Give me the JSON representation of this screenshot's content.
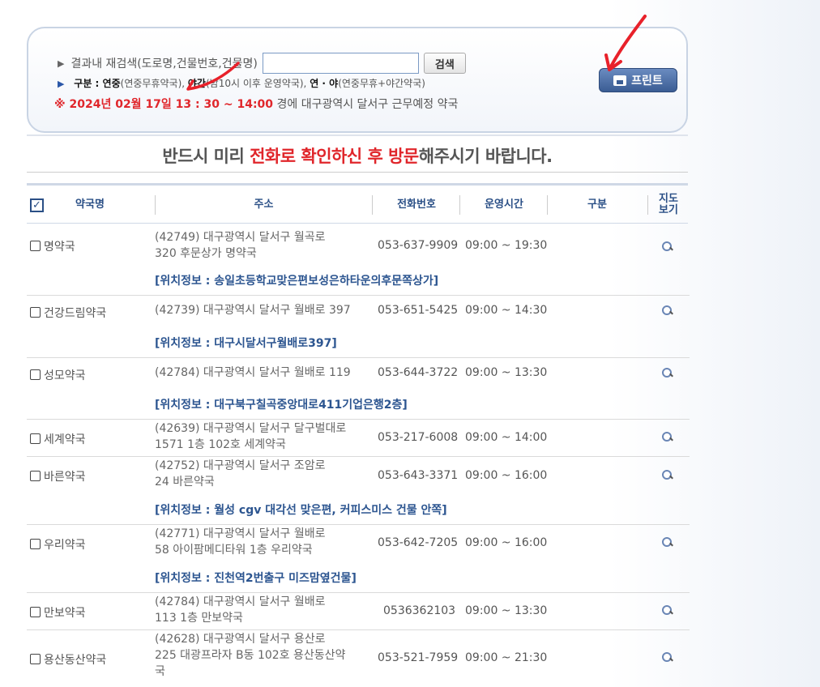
{
  "search": {
    "label": "결과내 재검색(도로명,건물번호,건물명)",
    "input_value": "",
    "button_label": "검색",
    "print_label": "프린트"
  },
  "category": {
    "prefix": "구분 : ",
    "yeonjung": "연중",
    "yeonjung_desc": "(연중무휴약국), ",
    "yagan": "야간",
    "yagan_desc": "(밤10시 이후 운영약국), ",
    "yeonya": "연 · 야",
    "yeonya_desc": "(연중무휴+야간약국)"
  },
  "datetime": {
    "mark": "※ 2024년 02월 17일 13 : 30 ~ 14:00",
    "suffix": " 경에  대구광역시  달서구   근무예정 약국"
  },
  "notice": {
    "pre": "반드시 미리 ",
    "highlight": "전화로 확인하신 후 방문",
    "post": "해주시기 바랍니다."
  },
  "table": {
    "headers": {
      "name": "약국명",
      "address": "주소",
      "phone": "전화번호",
      "hours": "운영시간",
      "category": "구분",
      "map": "지도 보기"
    },
    "rows": [
      {
        "name": "명약국",
        "addr1": "(42749) 대구광역시 달서구 월곡로",
        "addr2": "320 후문상가 명약국",
        "phone": "053-637-9909",
        "hours": "09:00 ~ 19:30",
        "location": "[위치정보 : 송일초등학교맞은편보성은하타운의후문쪽상가]"
      },
      {
        "name": "건강드림약국",
        "addr1": "(42739) 대구광역시 달서구 월배로 397",
        "addr2": "",
        "phone": "053-651-5425",
        "hours": "09:00 ~ 14:30",
        "location": "[위치정보 : 대구시달서구월배로397]"
      },
      {
        "name": "성모약국",
        "addr1": "(42784) 대구광역시 달서구 월배로 119",
        "addr2": "",
        "phone": "053-644-3722",
        "hours": "09:00 ~ 13:30",
        "location": "[위치정보 : 대구북구칠곡중앙대로411기업은행2층]"
      },
      {
        "name": "세계약국",
        "addr1": "(42639) 대구광역시 달서구 달구벌대로",
        "addr2": "1571 1층 102호 세계약국",
        "phone": "053-217-6008",
        "hours": "09:00 ~ 14:00",
        "location": ""
      },
      {
        "name": "바른약국",
        "addr1": "(42752) 대구광역시 달서구 조암로",
        "addr2": "24 바른약국",
        "phone": "053-643-3371",
        "hours": "09:00 ~ 16:00",
        "location": "[위치정보 : 월성 cgv 대각선 맞은편, 커피스미스 건물 안쪽]"
      },
      {
        "name": "우리약국",
        "addr1": "(42771) 대구광역시 달서구 월배로",
        "addr2": "58 아이팜메디타워 1층 우리약국",
        "phone": "053-642-7205",
        "hours": "09:00 ~ 16:00",
        "location": "[위치정보 : 진천역2번출구 미즈맘옆건물]"
      },
      {
        "name": "만보약국",
        "addr1": "(42784) 대구광역시 달서구 월배로",
        "addr2": "113 1층 만보약국",
        "phone": "0536362103",
        "hours": "09:00 ~ 13:30",
        "location": ""
      },
      {
        "name": "용산동산약국",
        "addr1": "(42628) 대구광역시 달서구 용산로",
        "addr2": "225 대광프라자 B동 102호 용산동산약",
        "addr3": "국",
        "phone": "053-521-7959",
        "hours": "09:00 ~ 21:30",
        "location": ""
      }
    ]
  },
  "colors": {
    "accent_blue": "#2a4f86",
    "highlight_red": "#e0262b",
    "annotation_red": "#e8212a"
  },
  "icons": {
    "map": "magnifier-icon",
    "print": "printer-icon"
  }
}
